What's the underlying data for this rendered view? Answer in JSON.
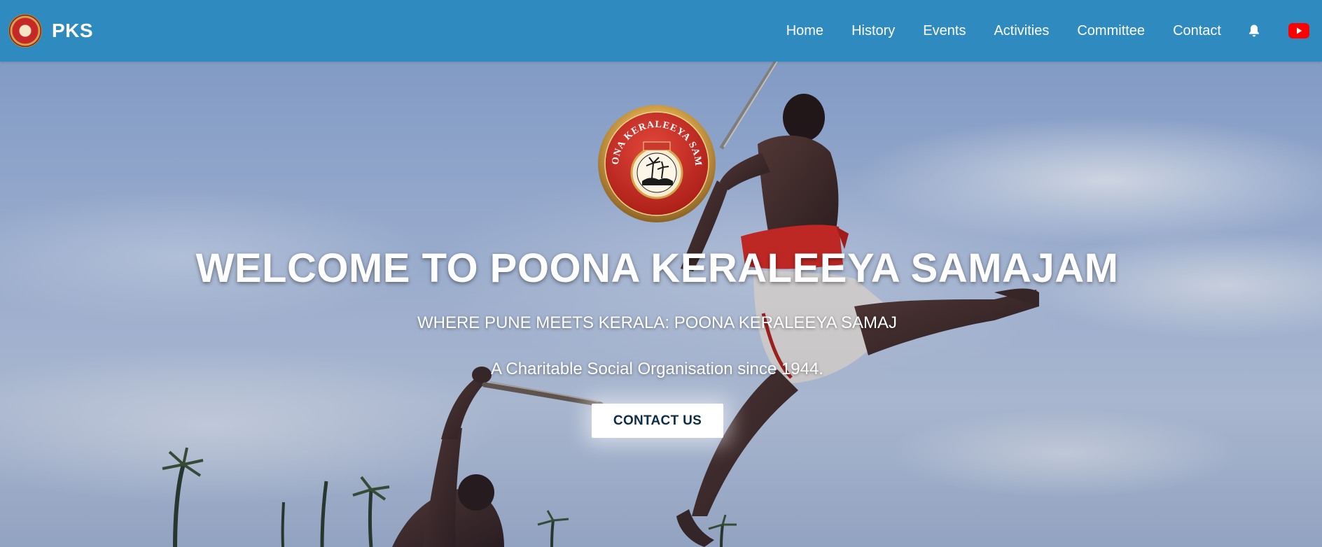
{
  "nav": {
    "brand": "PKS",
    "links": [
      "Home",
      "History",
      "Events",
      "Activities",
      "Committee",
      "Contact"
    ],
    "icons": [
      "bell-icon",
      "youtube-icon"
    ]
  },
  "hero": {
    "emblem_text": "POONA KERALEEYA SAMAJ",
    "title": "WELCOME TO POONA KERALEEYA SAMAJAM",
    "subtitle": "WHERE PUNE MEETS KERALA: POONA KERALEEYA SAMAJ",
    "tagline": "A Charitable Social Organisation since 1944.",
    "button": "CONTACT US"
  },
  "colors": {
    "navbar": "#2f8ac0",
    "button_text": "#0d2c46",
    "youtube": "#ff0000",
    "emblem_red": "#c62828",
    "emblem_gold": "#d4a44a"
  }
}
